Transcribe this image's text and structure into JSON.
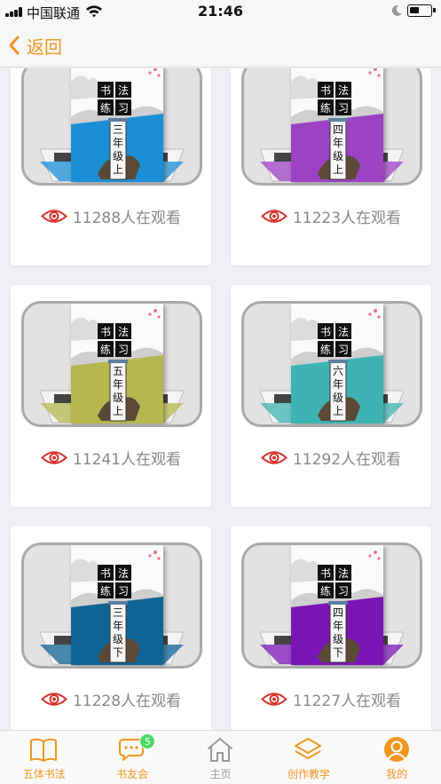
{
  "status_bar": {
    "carrier": "中国联通",
    "time": "21:46"
  },
  "nav": {
    "back_label": "返回"
  },
  "theme": {
    "accent": "#f0961e",
    "inactive": "#999999",
    "eye": "#d6322d",
    "badge": "#4cd964"
  },
  "book_title": [
    "书",
    "法",
    "练",
    "习"
  ],
  "cards": [
    {
      "grade": "三年级上",
      "views": "11288人在观看",
      "color": "#1b8fd6"
    },
    {
      "grade": "四年级上",
      "views": "11223人在观看",
      "color": "#9d42c4"
    },
    {
      "grade": "五年级上",
      "views": "11241人在观看",
      "color": "#b5b84f"
    },
    {
      "grade": "六年级上",
      "views": "11292人在观看",
      "color": "#3fb3b3"
    },
    {
      "grade": "三年级下",
      "views": "11228人在观看",
      "color": "#0f6496"
    },
    {
      "grade": "四年级下",
      "views": "11227人在观看",
      "color": "#7b14b5"
    }
  ],
  "tabs": [
    {
      "label": "五体书法",
      "icon": "book-icon",
      "active": true
    },
    {
      "label": "书友会",
      "icon": "chat-icon",
      "active": true,
      "badge": "5"
    },
    {
      "label": "主页",
      "icon": "home-icon",
      "active": false
    },
    {
      "label": "创作教学",
      "icon": "layers-icon",
      "active": true
    },
    {
      "label": "我的",
      "icon": "profile-icon",
      "active": true
    }
  ]
}
